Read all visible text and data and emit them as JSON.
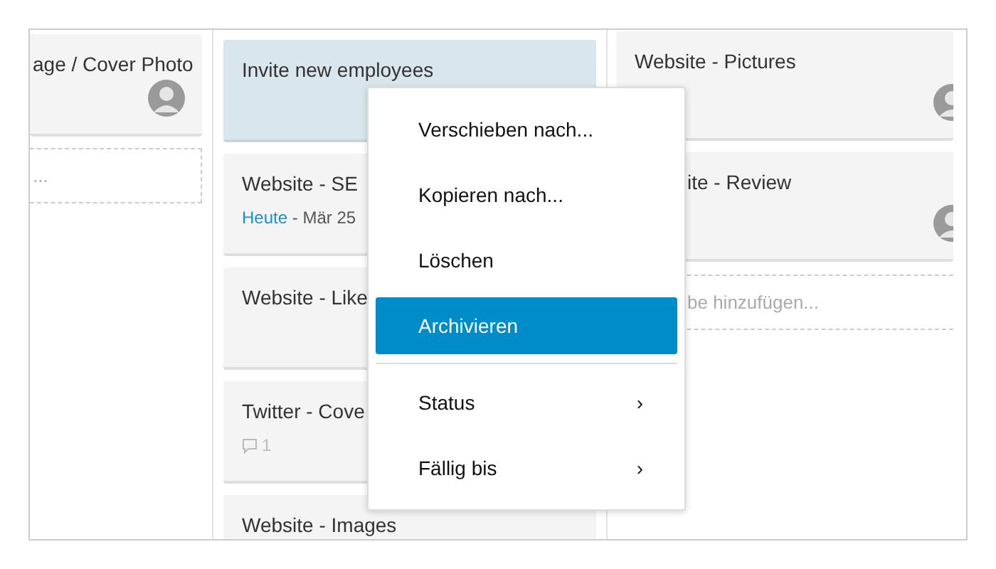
{
  "columns": [
    {
      "cards": [
        {
          "title": "age / Cover Photo",
          "selected": false,
          "avatar": true
        }
      ],
      "add_task": "..."
    },
    {
      "cards": [
        {
          "title": "Invite new employees",
          "selected": true,
          "avatar": false
        },
        {
          "title": "Website - SE",
          "selected": false,
          "avatar": false,
          "due_today": "Heute",
          "due_rest": "- Mär 25"
        },
        {
          "title": "Website - Like",
          "selected": false,
          "avatar": false
        },
        {
          "title": "Twitter - Cove",
          "selected": false,
          "avatar": false,
          "comments": "1"
        },
        {
          "title": "Website - Images",
          "selected": false,
          "avatar": false
        }
      ]
    },
    {
      "cards": [
        {
          "title": "Website - Pictures",
          "selected": false,
          "avatar": true
        },
        {
          "title": "ite - Review",
          "selected": false,
          "avatar": true
        }
      ],
      "add_task": "be hinzufügen..."
    }
  ],
  "context_menu": {
    "items": [
      {
        "label": "Verschieben nach...",
        "selected": false,
        "separator_before": false
      },
      {
        "label": "Kopieren nach...",
        "selected": false,
        "separator_before": false
      },
      {
        "label": "Löschen",
        "selected": false,
        "separator_before": false
      },
      {
        "label": "Archivieren",
        "selected": true,
        "separator_before": false
      },
      {
        "label": "Status",
        "selected": false,
        "separator_before": true,
        "submenu": "›"
      },
      {
        "label": "Fällig bis",
        "selected": false,
        "separator_before": false,
        "submenu": "›"
      }
    ]
  }
}
